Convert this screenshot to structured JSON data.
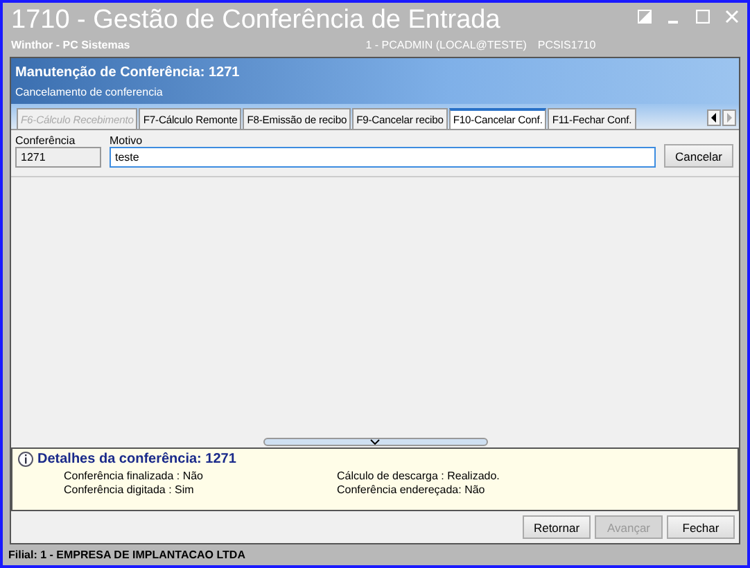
{
  "window": {
    "title": "1710 - Gestão de Conferência de Entrada",
    "subtitle": "Winthor - PC Sistemas",
    "user": "1 - PCADMIN (LOCAL@TESTE)",
    "program": "PCSIS1710"
  },
  "header": {
    "title": "Manutenção de Conferência: 1271",
    "subtitle": "Cancelamento de conferencia"
  },
  "tabs": [
    {
      "label": "F6-Cálculo Recebimento",
      "selected": false,
      "disabled": true
    },
    {
      "label": "F7-Cálculo Remonte",
      "selected": false,
      "disabled": false
    },
    {
      "label": "F8-Emissão de recibo",
      "selected": false,
      "disabled": false
    },
    {
      "label": "F9-Cancelar recibo",
      "selected": false,
      "disabled": false
    },
    {
      "label": "F10-Cancelar Conf.",
      "selected": true,
      "disabled": false
    },
    {
      "label": "F11-Fechar Conf.",
      "selected": false,
      "disabled": false
    }
  ],
  "form": {
    "conferencia": {
      "label": "Conferência",
      "value": "1271"
    },
    "motivo": {
      "label": "Motivo",
      "value": "teste"
    },
    "cancel_button": "Cancelar"
  },
  "details": {
    "title": "Detalhes da conferência: 1271",
    "lines": [
      "Conferência finalizada : Não",
      "Cálculo de descarga : Realizado.",
      "Conferência digitada : Sim",
      "Conferência endereçada: Não"
    ]
  },
  "buttons": [
    {
      "label": "Retornar",
      "disabled": false
    },
    {
      "label": "Avançar",
      "disabled": true
    },
    {
      "label": "Fechar",
      "disabled": false
    }
  ],
  "status_bar": "Filial: 1 - EMPRESA DE IMPLANTACAO LTDA"
}
